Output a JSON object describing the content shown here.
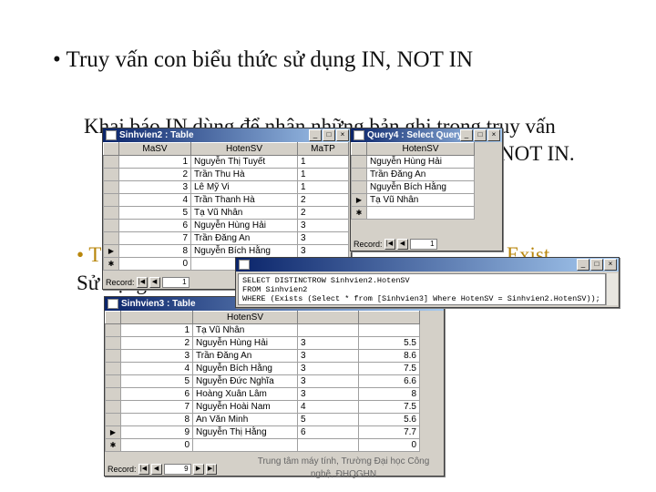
{
  "slide": {
    "bullet1": "• Truy vấn con biểu thức sử dụng IN, NOT IN",
    "para1_line1": "Khai báo IN dùng để nhận những bản ghi trong truy vấn",
    "para1_line2_end": "NOT IN.",
    "bullet2_start": "• T",
    "bullet2_end": "Exist",
    "para2_start": "Sử dụng",
    "footer": "Trung tâm máy tính, Trường Đại học Công nghệ, ĐHQGHN"
  },
  "table1": {
    "title": "Sinhvien2 : Table",
    "columns": [
      "MaSV",
      "HotenSV",
      "MaTP"
    ],
    "rows": [
      [
        "1",
        "Nguyễn Thị Tuyết",
        "1"
      ],
      [
        "2",
        "Trần Thu Hà",
        "1"
      ],
      [
        "3",
        "Lê Mỹ Vi",
        "1"
      ],
      [
        "4",
        "Trần Thanh Hà",
        "2"
      ],
      [
        "5",
        "Tạ Vũ Nhân",
        "2"
      ],
      [
        "6",
        "Nguyễn Hùng Hải",
        "3"
      ],
      [
        "7",
        "Trần Đăng An",
        "3"
      ],
      [
        "8",
        "Nguyễn Bích Hằng",
        "3"
      ],
      [
        "0",
        "",
        ""
      ]
    ],
    "record_label": "Record:",
    "record_value": "1"
  },
  "query4": {
    "title": "Query4 : Select Query",
    "columns": [
      "HotenSV"
    ],
    "rows": [
      "Nguyễn Hùng Hải",
      "Trần Đăng An",
      "Nguyễn Bích Hằng",
      "Tạ Vũ Nhân",
      ""
    ],
    "record_label": "Record:",
    "record_value": "1"
  },
  "sqlwin": {
    "title": "",
    "line1": "SELECT DISTINCTROW Sinhvien2.HotenSV",
    "line2": "FROM Sinhvien2",
    "line3": "WHERE (Exists (Select * from [Sinhvien3] Where HotenSV = Sinhvien2.HotenSV));"
  },
  "table3": {
    "title": "Sinhvien3 : Table",
    "columns": [
      "",
      "HotenSV",
      "",
      ""
    ],
    "rows": [
      [
        "1",
        "Tạ Vũ Nhân",
        "",
        ""
      ],
      [
        "2",
        "Nguyễn Hùng Hải",
        "3",
        "5.5"
      ],
      [
        "3",
        "Trần Đăng An",
        "3",
        "8.6"
      ],
      [
        "4",
        "Nguyễn Bích Hằng",
        "3",
        "7.5"
      ],
      [
        "5",
        "Nguyễn Đức Nghĩa",
        "3",
        "6.6"
      ],
      [
        "6",
        "Hoàng Xuân Lâm",
        "3",
        "8"
      ],
      [
        "7",
        "Nguyễn Hoài Nam",
        "4",
        "7.5"
      ],
      [
        "8",
        "An Văn Minh",
        "5",
        "5.6"
      ],
      [
        "9",
        "Nguyễn Thị Hằng",
        "6",
        "7.7"
      ],
      [
        "0",
        "",
        "",
        "0"
      ]
    ],
    "record_label": "Record:",
    "record_value": "9"
  }
}
